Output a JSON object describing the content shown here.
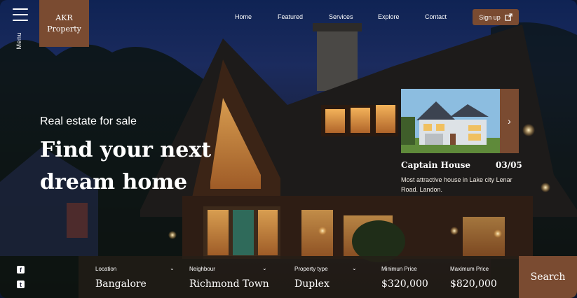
{
  "sidebar": {
    "menu_label": "Menu"
  },
  "brand": {
    "line1": "AKR",
    "line2": "Property"
  },
  "nav": {
    "links": [
      "Home",
      "Featured",
      "Services",
      "Explore",
      "Contact"
    ],
    "signup_label": "Sign up"
  },
  "hero": {
    "subtitle": "Real estate for sale",
    "title_line1": "Find your next",
    "title_line2": "dream home"
  },
  "featured_card": {
    "name": "Captain House",
    "index": "03/05",
    "description": "Most attractive house in Lake city Lenar Road. Landon."
  },
  "search": {
    "location": {
      "label": "Location",
      "value": "Bangalore"
    },
    "neighbour": {
      "label": "Neighbour",
      "value": "Richmond Town"
    },
    "property_type": {
      "label": "Property type",
      "value": "Duplex"
    },
    "min_price": {
      "label": "Minimun Price",
      "value": "$320,000"
    },
    "max_price": {
      "label": "Maximum Price",
      "value": "$820,000"
    },
    "button_label": "Search"
  },
  "icons": {
    "menu": "hamburger-icon",
    "external": "external-link-icon",
    "card_next": "chevron-right-icon",
    "social": [
      "facebook-icon",
      "twitter-icon"
    ]
  },
  "colors": {
    "accent": "#7a4b31",
    "sky": "#0f2354",
    "searchbar": "#261e18"
  }
}
